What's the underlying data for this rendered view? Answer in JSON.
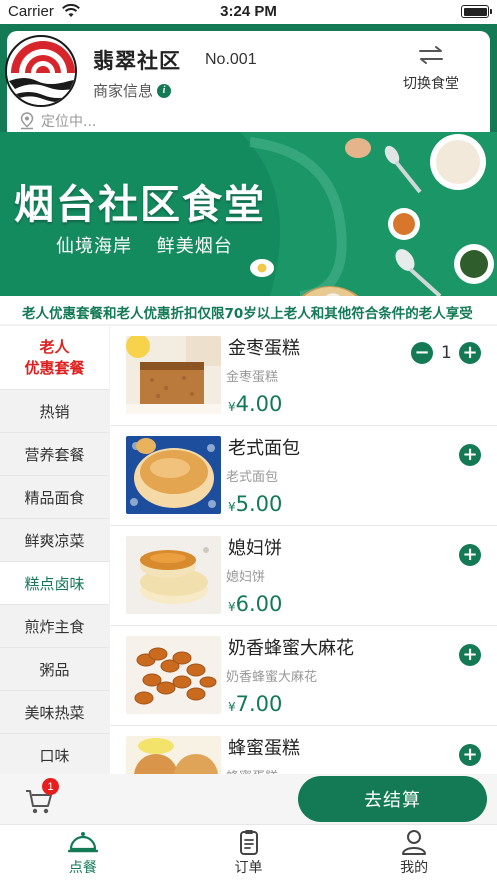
{
  "status_bar": {
    "carrier": "Carrier",
    "time": "3:24 PM"
  },
  "header": {
    "store_name": "翡翠社区",
    "store_no": "No.001",
    "merchant_info": "商家信息",
    "switch_label": "切换食堂",
    "location": "定位中..."
  },
  "banner": {
    "title": "烟台社区食堂",
    "slogan_1": "仙境海岸",
    "slogan_2": "鲜美烟台"
  },
  "notice": "老人优惠套餐和老人优惠折扣仅限70岁以上老人和其他符合条件的老人享受",
  "categories": [
    {
      "label_1": "老人",
      "label_2": "优惠套餐"
    },
    {
      "label": "热销"
    },
    {
      "label": "营养套餐"
    },
    {
      "label": "精品面食"
    },
    {
      "label": "鲜爽凉菜"
    },
    {
      "label": "糕点卤味"
    },
    {
      "label": "煎炸主食"
    },
    {
      "label": "粥品"
    },
    {
      "label": "美味热菜"
    },
    {
      "label": "口味"
    }
  ],
  "products": [
    {
      "name": "金枣蛋糕",
      "subtitle": "金枣蛋糕",
      "currency": "¥",
      "price": "4.00",
      "quantity": "1"
    },
    {
      "name": "老式面包",
      "subtitle": "老式面包",
      "currency": "¥",
      "price": "5.00"
    },
    {
      "name": "媳妇饼",
      "subtitle": "媳妇饼",
      "currency": "¥",
      "price": "6.00"
    },
    {
      "name": "奶香蜂蜜大麻花",
      "subtitle": "奶香蜂蜜大麻花",
      "currency": "¥",
      "price": "7.00"
    },
    {
      "name": "蜂蜜蛋糕",
      "subtitle": "蜂蜜蛋糕"
    }
  ],
  "cart": {
    "badge_count": "1",
    "checkout_label": "去结算"
  },
  "tabs": [
    {
      "label": "点餐"
    },
    {
      "label": "订单"
    },
    {
      "label": "我的"
    }
  ],
  "colors": {
    "brand_green": "#137a55",
    "badge_red": "#e81e1e",
    "category_red": "#e02020"
  }
}
